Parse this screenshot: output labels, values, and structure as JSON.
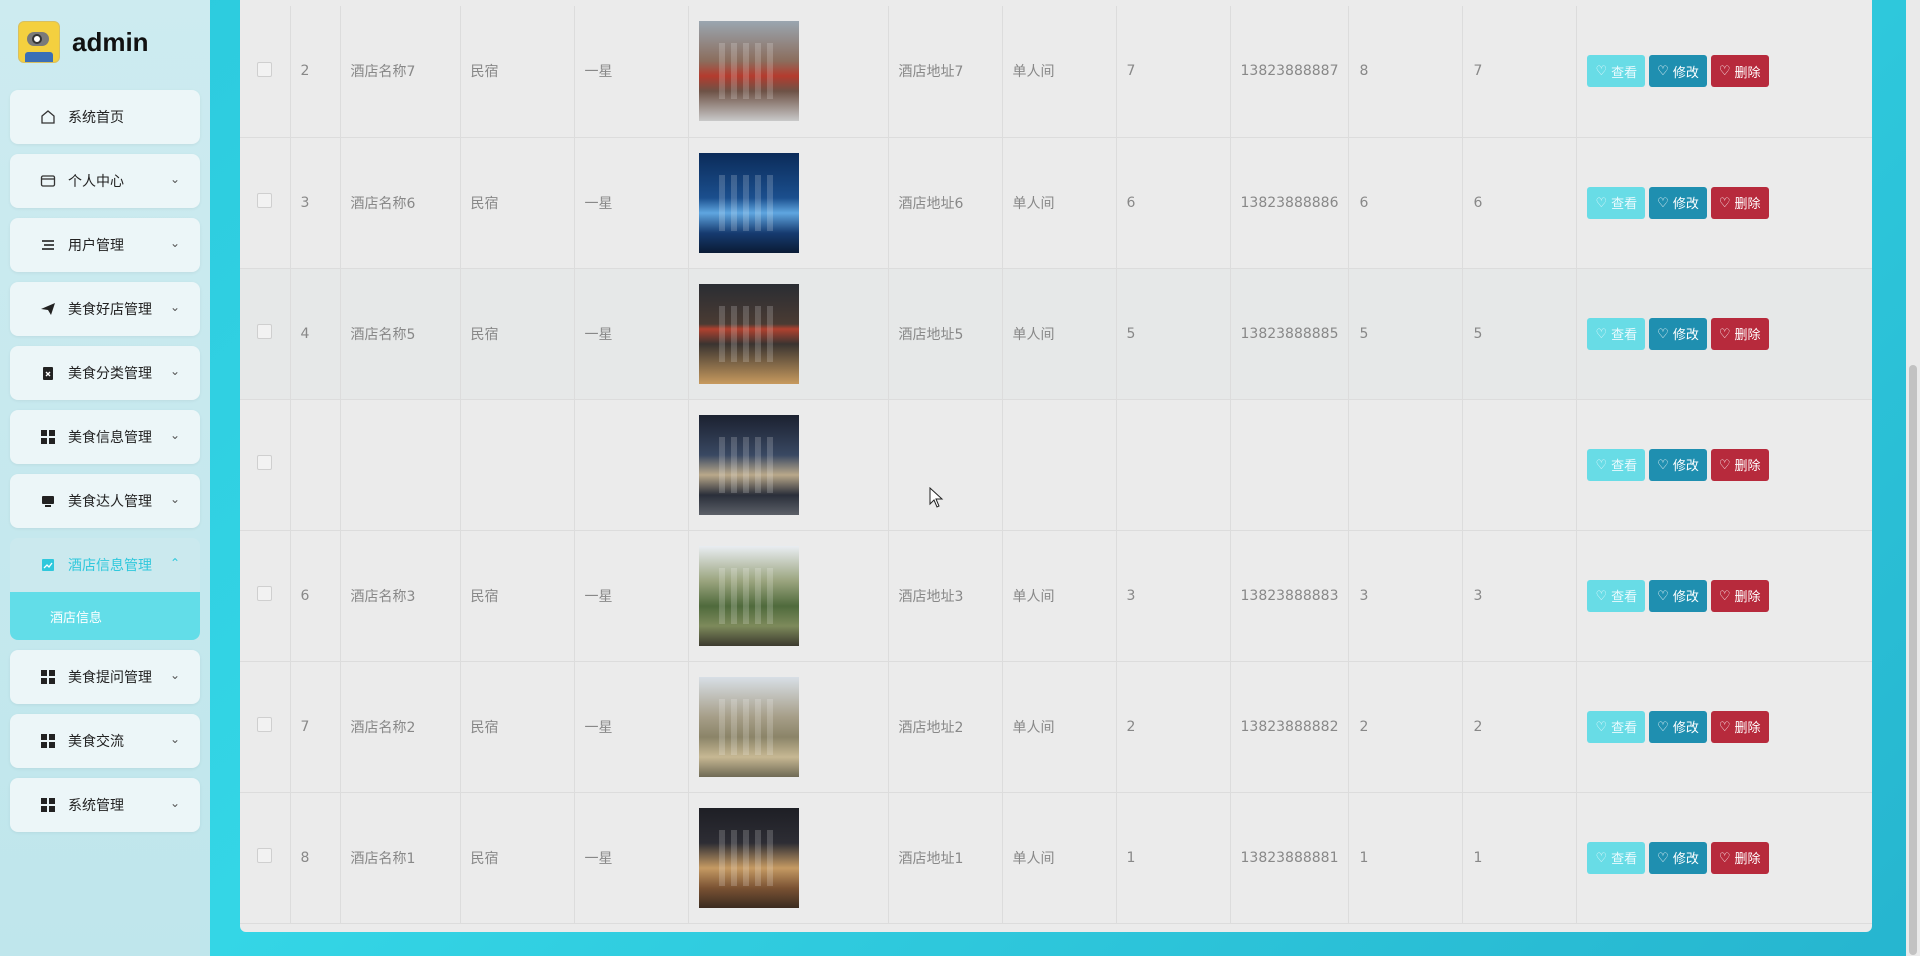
{
  "brand": {
    "name": "admin"
  },
  "menu": [
    {
      "label": "系统首页",
      "icon": "home-icon",
      "has_chevron": false
    },
    {
      "label": "个人中心",
      "icon": "card-icon",
      "has_chevron": true
    },
    {
      "label": "用户管理",
      "icon": "list-icon",
      "has_chevron": true
    },
    {
      "label": "美食好店管理",
      "icon": "send-icon",
      "has_chevron": true
    },
    {
      "label": "美食分类管理",
      "icon": "clipboard-icon",
      "has_chevron": true
    },
    {
      "label": "美食信息管理",
      "icon": "grid-icon",
      "has_chevron": true
    },
    {
      "label": "美食达人管理",
      "icon": "monitor-icon",
      "has_chevron": true
    },
    {
      "label": "酒店信息管理",
      "icon": "chart-icon",
      "has_chevron": true,
      "expanded": true
    },
    {
      "label": "美食提问管理",
      "icon": "grid-icon",
      "has_chevron": true
    },
    {
      "label": "美食交流",
      "icon": "grid-icon",
      "has_chevron": true
    },
    {
      "label": "系统管理",
      "icon": "grid-icon",
      "has_chevron": true
    }
  ],
  "submenu": {
    "label": "酒店信息"
  },
  "actions": {
    "view": "查看",
    "edit": "修改",
    "delete": "删除"
  },
  "rows": [
    {
      "idx": "2",
      "name": "酒店名称7",
      "type": "民宿",
      "star": "一星",
      "address": "酒店地址7",
      "room": "单人间",
      "a": "7",
      "phone": "13823888887",
      "b": "8",
      "c": "7"
    },
    {
      "idx": "3",
      "name": "酒店名称6",
      "type": "民宿",
      "star": "一星",
      "address": "酒店地址6",
      "room": "单人间",
      "a": "6",
      "phone": "13823888886",
      "b": "6",
      "c": "6"
    },
    {
      "idx": "4",
      "name": "酒店名称5",
      "type": "民宿",
      "star": "一星",
      "address": "酒店地址5",
      "room": "单人间",
      "a": "5",
      "phone": "13823888885",
      "b": "5",
      "c": "5"
    },
    {
      "idx": "",
      "name": "",
      "type": "",
      "star": "",
      "address": "",
      "room": "",
      "a": "",
      "phone": "",
      "b": "",
      "c": ""
    },
    {
      "idx": "6",
      "name": "酒店名称3",
      "type": "民宿",
      "star": "一星",
      "address": "酒店地址3",
      "room": "单人间",
      "a": "3",
      "phone": "13823888883",
      "b": "3",
      "c": "3"
    },
    {
      "idx": "7",
      "name": "酒店名称2",
      "type": "民宿",
      "star": "一星",
      "address": "酒店地址2",
      "room": "单人间",
      "a": "2",
      "phone": "13823888882",
      "b": "2",
      "c": "2"
    },
    {
      "idx": "8",
      "name": "酒店名称1",
      "type": "民宿",
      "star": "一星",
      "address": "酒店地址1",
      "room": "单人间",
      "a": "1",
      "phone": "13823888881",
      "b": "1",
      "c": "1"
    }
  ],
  "colors": {
    "accent": "#2fc8dc",
    "view_btn": "#68dce6",
    "edit_btn": "#1f8fb0",
    "delete_btn": "#b72a3c"
  }
}
